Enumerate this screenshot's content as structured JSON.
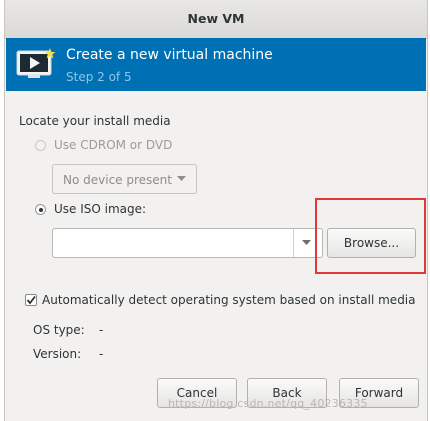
{
  "window": {
    "title": "New VM"
  },
  "header": {
    "title": "Create a new virtual machine",
    "step": "Step 2 of 5",
    "header_color": "#0070b5"
  },
  "install_media": {
    "section_label": "Locate your install media",
    "cdrom_option": {
      "label": "Use CDROM or DVD",
      "selected": false,
      "enabled": false
    },
    "cdrom_device": {
      "value": "No device present",
      "enabled": false
    },
    "iso_option": {
      "label": "Use ISO image:",
      "selected": true
    },
    "iso_path": {
      "value": ""
    },
    "browse_label": "Browse..."
  },
  "auto_detect": {
    "label": "Automatically detect operating system based on install media",
    "checked": true
  },
  "os_info": {
    "os_type_label": "OS type:",
    "os_type_value": "-",
    "version_label": "Version:",
    "version_value": "-"
  },
  "buttons": {
    "cancel": "Cancel",
    "back": "Back",
    "forward": "Forward"
  },
  "annotation": {
    "highlight_color": "#e0393a",
    "target": "browse-button"
  },
  "watermark": "https://blog.csdn.net/qq_40236335"
}
